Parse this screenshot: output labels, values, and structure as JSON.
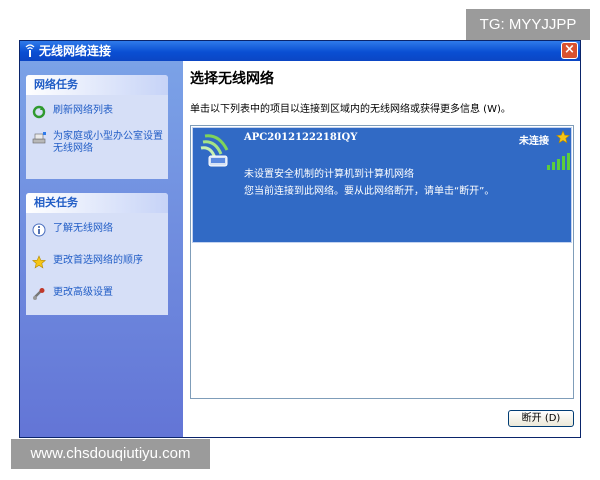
{
  "watermarks": {
    "top_right": "TG: MYYJJPP",
    "bottom_left": "www.chsdouqiutiyu.com"
  },
  "window": {
    "title": "无线网络连接",
    "close_label": "×"
  },
  "sidebar": {
    "network_tasks": {
      "heading": "网络任务",
      "items": [
        {
          "label": "刷新网络列表",
          "icon": "refresh-icon"
        },
        {
          "label": "为家庭或小型办公室设置无线网络",
          "icon": "home-network-setup-icon"
        }
      ]
    },
    "related_tasks": {
      "heading": "相关任务",
      "items": [
        {
          "label": "了解无线网络",
          "icon": "info-icon"
        },
        {
          "label": "更改首选网络的顺序",
          "icon": "star-icon"
        },
        {
          "label": "更改高级设置",
          "icon": "settings-icon"
        }
      ]
    }
  },
  "main": {
    "title": "选择无线网络",
    "description": "单击以下列表中的项目以连接到区域内的无线网络或获得更多信息 (W)。",
    "networks": [
      {
        "name": "APC2012122218IQY",
        "status": "未连接",
        "security_text": "未设置安全机制的计算机到计算机网络",
        "info_text": "您当前连接到此网络。要从此网络断开，请单击“断开”。",
        "preferred": true,
        "signal_bars": 5
      }
    ],
    "disconnect_label": "断开 (D)"
  },
  "colors": {
    "title_bar": "#0a4fd3",
    "sidebar": "#6f8ede",
    "selected_row": "#316ac5",
    "link_text": "#215dc6",
    "signal": "#5ccd3b"
  }
}
